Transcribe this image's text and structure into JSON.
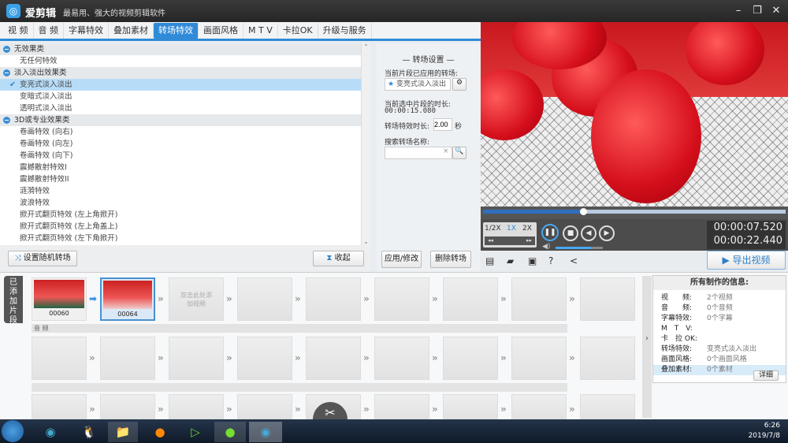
{
  "app": {
    "name": "爱剪辑",
    "slogan": "最易用、强大的视频剪辑软件"
  },
  "tabs": [
    "视 频",
    "音 频",
    "字幕特效",
    "叠加素材",
    "转场特效",
    "画面风格",
    "M T V",
    "卡拉OK",
    "升级与服务"
  ],
  "active_tab": 4,
  "effects": [
    {
      "group": "无效果类",
      "items": [
        "无任何特效"
      ]
    },
    {
      "group": "淡入淡出效果类",
      "items": [
        "变亮式淡入淡出",
        "变暗式淡入淡出",
        "透明式淡入淡出"
      ]
    },
    {
      "group": "3D或专业效果类",
      "items": [
        "卷画特效 (向右)",
        "卷画特效 (向左)",
        "卷画特效 (向下)",
        "震撼散射特效I",
        "震撼散射特效II",
        "涟漪特效",
        "波浪特效",
        "掀开式翻页特效 (左上角掀开)",
        "掀开式翻页特效 (左上角盖上)",
        "掀开式翻页特效 (左下角掀开)"
      ]
    }
  ],
  "selected_effect": "变亮式淡入淡出",
  "left_buttons": {
    "random": "设置随机转场",
    "collapse": "收起"
  },
  "settings": {
    "title": "转场设置",
    "applied_label": "当前片段已应用的转场:",
    "applied_value": "变亮式淡入淡出",
    "duration_label": "当前选中片段的时长:",
    "duration_value": "00:00:15.080",
    "effect_len_label": "转场特效时长:",
    "effect_len_value": "2.00",
    "effect_len_unit": "秒",
    "search_label": "搜索转场名称:",
    "search_value": "",
    "apply": "应用/修改",
    "delete": "删除转场"
  },
  "player": {
    "progress": 0.33,
    "volume": 0.75,
    "speeds": [
      "1/2X",
      "1X",
      "2X"
    ],
    "current_time": "00:00:07.520",
    "total_time": "00:00:22.440",
    "export": "导出视频"
  },
  "timeline": {
    "side_tab": "已添加片段",
    "clips": [
      {
        "label": "00060"
      },
      {
        "label": "00064"
      }
    ],
    "add_hint": "双击此处添加视频",
    "audio_label": "音 频"
  },
  "info": {
    "title": "所有制作的信息:",
    "rows": [
      {
        "k": "视　　频:",
        "v": "2个视频"
      },
      {
        "k": "音　　频:",
        "v": "0个音频"
      },
      {
        "k": "字幕特效:",
        "v": "0个字幕"
      },
      {
        "k": "M　T　V:",
        "v": ""
      },
      {
        "k": "卡　拉 OK:",
        "v": ""
      },
      {
        "k": "转场特效:",
        "v": "变亮式淡入淡出"
      },
      {
        "k": "画面风格:",
        "v": "0个画面风格"
      },
      {
        "k": "叠加素材:",
        "v": "0个素材"
      }
    ],
    "detail": "详细"
  },
  "clock": {
    "time": "6:26",
    "date": "2019/7/8"
  }
}
